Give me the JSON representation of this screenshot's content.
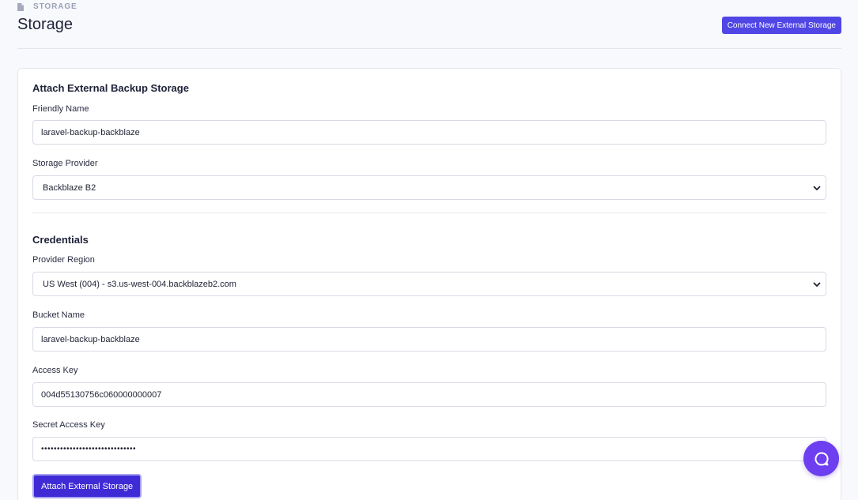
{
  "header": {
    "breadcrumb": "STORAGE",
    "title": "Storage",
    "connect_button": "Connect New External Storage"
  },
  "form": {
    "section_title": "Attach External Backup Storage",
    "friendly_name": {
      "label": "Friendly Name",
      "value": "laravel-backup-backblaze"
    },
    "storage_provider": {
      "label": "Storage Provider",
      "value": "Backblaze B2"
    },
    "credentials_title": "Credentials",
    "provider_region": {
      "label": "Provider Region",
      "value": "US West (004) - s3.us-west-004.backblazeb2.com"
    },
    "bucket_name": {
      "label": "Bucket Name",
      "value": "laravel-backup-backblaze"
    },
    "access_key": {
      "label": "Access Key",
      "value": "004d55130756c060000000007"
    },
    "secret_access_key": {
      "label": "Secret Access Key",
      "value": "••••••••••••••••••••••••••••••"
    },
    "submit_button": "Attach External Storage"
  },
  "colors": {
    "accent": "#4f46e5",
    "submit": "#3f2bd6",
    "help_fab": "#6d3ff0"
  },
  "icons": {
    "breadcrumb": "document-icon",
    "select": "chevron-down-icon",
    "help": "chat-bubble-icon"
  }
}
